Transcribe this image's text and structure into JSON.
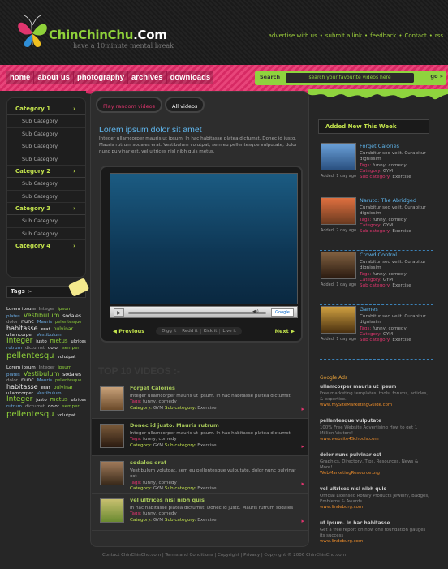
{
  "logo": {
    "name_part1": "ChinChinChu",
    "name_part2": ".Com",
    "tagline": "have a 10minute mental break"
  },
  "toplinks": [
    "advertise with us",
    "submit a link",
    "feedback",
    "Contact",
    "rss"
  ],
  "nav": [
    "home",
    "about us",
    "photography",
    "archives",
    "downloads"
  ],
  "search": {
    "label": "Search",
    "placeholder": "search your favourite videos here",
    "go": "go"
  },
  "tabs": [
    "Play random videos",
    "All videos"
  ],
  "sidebar": [
    {
      "label": "Category 1",
      "subs": [
        "Sub Category",
        "Sub Category",
        "Sub Category",
        "Sub Category"
      ]
    },
    {
      "label": "Category 2",
      "subs": [
        "Sub Category",
        "Sub Category"
      ]
    },
    {
      "label": "Category 3",
      "subs": [
        "Sub Category",
        "Sub Category"
      ]
    },
    {
      "label": "Category 4",
      "subs": []
    }
  ],
  "tags_title": "Tags",
  "tag_cloud": [
    {
      "t": "Lorem ipsum",
      "c": "w2",
      "s": 5.5
    },
    {
      "t": "Integer",
      "c": "gr",
      "s": 5.5
    },
    {
      "t": "ipsum",
      "c": "g",
      "s": 5.5
    },
    {
      "t": "plates",
      "c": "b",
      "s": 5.5
    },
    {
      "t": "Vestibulum",
      "c": "g",
      "s": 8
    },
    {
      "t": "sodales",
      "c": "w2",
      "s": 6
    },
    {
      "t": "dolor",
      "c": "gr",
      "s": 5.5
    },
    {
      "t": "nunc",
      "c": "w2",
      "s": 6.5
    },
    {
      "t": "Mauris",
      "c": "b",
      "s": 5.5
    },
    {
      "t": "pellentesque",
      "c": "g",
      "s": 5
    },
    {
      "t": "habitasse",
      "c": "w2",
      "s": 8
    },
    {
      "t": "erat",
      "c": "w2",
      "s": 5.5
    },
    {
      "t": "pulvinar",
      "c": "g",
      "s": 6
    },
    {
      "t": "ullamcorper",
      "c": "w2",
      "s": 5.5
    },
    {
      "t": "Vestibulum",
      "c": "b",
      "s": 5.5
    },
    {
      "t": "Integer",
      "c": "g",
      "s": 9
    },
    {
      "t": "justo",
      "c": "w2",
      "s": 5.5
    },
    {
      "t": "metus",
      "c": "g",
      "s": 7
    },
    {
      "t": "ultrices",
      "c": "w2",
      "s": 5
    },
    {
      "t": "rutrum",
      "c": "b",
      "s": 5.5
    },
    {
      "t": "dictumst",
      "c": "gr",
      "s": 5.5
    },
    {
      "t": "dolor",
      "c": "w2",
      "s": 5.5
    },
    {
      "t": "semper",
      "c": "g",
      "s": 5.5
    },
    {
      "t": "pellentesqu",
      "c": "g",
      "s": 10
    },
    {
      "t": "volutpat",
      "c": "w2",
      "s": 5.5
    }
  ],
  "main": {
    "heading": "Lorem ipsum dolor sit amet",
    "intro": "Integer ullamcorper mauris ut ipsum. In hac habitasse platea dictumst. Donec id justo. Mauris rutrum sodales erat. Vestibulum volutpat, sem eu pellentesque vulputate, dolor nunc pulvinar est, vel ultrices nisl nibh quis metus."
  },
  "player": {
    "prev": "Previous",
    "next": "Next",
    "social": [
      "Digg it",
      "Redd it",
      "Kick it",
      "Live it"
    ],
    "google": "Google"
  },
  "top10_title": "TOP 10 VIDEOS :-",
  "videos": [
    {
      "title": "Forget Calories",
      "desc": "Integer ullamcorper mauris ut ipsum. In hac habitasse platea dictumst",
      "tags": "funny, comedy",
      "cat": "GYM",
      "subcat": "Exercise"
    },
    {
      "title": "Donec id justo. Mauris rutrum",
      "desc": "Integer ullamcorper mauris ut ipsum. In hac habitasse platea dictumst",
      "tags": "funny, comedy",
      "cat": "GYM",
      "subcat": "Exercise"
    },
    {
      "title": "sodales erat",
      "desc": "Vestibulum volutpat, sem eu pellentesque vulputate, dolor nunc pulvinar est",
      "tags": "funny, comedy",
      "cat": "GYM",
      "subcat": "Exercise"
    },
    {
      "title": "vel ultrices nisl nibh quis",
      "desc": "In hac habitasse platea dictumst. Donec id justo. Mauris rutrum sodales",
      "tags": "funny, comedy",
      "cat": "GYM",
      "subcat": "Exercise"
    }
  ],
  "added_title": "Added New This Week",
  "added": [
    {
      "title": "Forget Calories",
      "desc": "Curabitur sed velit. Curabitur dignissim",
      "tags": "funny, comedy",
      "cat": "GYM",
      "subcat": "Exercise",
      "added": "Added: 1 day ago"
    },
    {
      "title": "Naruto: The Abridged",
      "desc": "Curabitur sed velit. Curabitur dignissim",
      "tags": "funny, comedy",
      "cat": "GYM",
      "subcat": "Exercise",
      "added": "Added: 2 day ago"
    },
    {
      "title": "Crowd Control",
      "desc": "Curabitur sed velit. Curabitur dignissim",
      "tags": "funny, comedy",
      "cat": "GYM",
      "subcat": "Exercise",
      "added": "Added: 1 day ago"
    },
    {
      "title": "Games",
      "desc": "Curabitur sed velit. Curabitur dignissim",
      "tags": "funny, comedy",
      "cat": "GYM",
      "subcat": "Exercise",
      "added": "Added: 1 day ago"
    }
  ],
  "ads_title": "Google Ads",
  "ads": [
    {
      "t": "ullamcorper mauris ut ipsum",
      "b": "Free marketing templates, tools, forums, articles, & expertise.",
      "u": "www.mySiteMarketingGuide.com"
    },
    {
      "t": "pellentesque vulputate",
      "b": "100% Free Website Advertising How to get 1 Million Visitors!",
      "u": "www.website4Schools.com"
    },
    {
      "t": "dolor nunc pulvinar est",
      "b": "Graphics, Directory, Tips, Resources, News & More!",
      "u": "WebMarketingResource.org"
    },
    {
      "t": "vel ultrices nisl nibh quis",
      "b": "Official Licensed Rotary Products Jewelry, Badges, Emblems & Awards",
      "u": "www.lindeburg.com"
    },
    {
      "t": "ut ipsum. In hac habitasse",
      "b": "Get a free report on how one foundation gauges its success",
      "u": "www.lindeburg.com"
    }
  ],
  "footer": "Contact ChinChinChu.com  |  Terms and Conditions  |  Copyright  |  Privacy  |  Copyright © 2006 ChinChinChu.com",
  "labels": {
    "tags": "Tags:",
    "category": "Category:",
    "subcategory": "Sub category:"
  }
}
